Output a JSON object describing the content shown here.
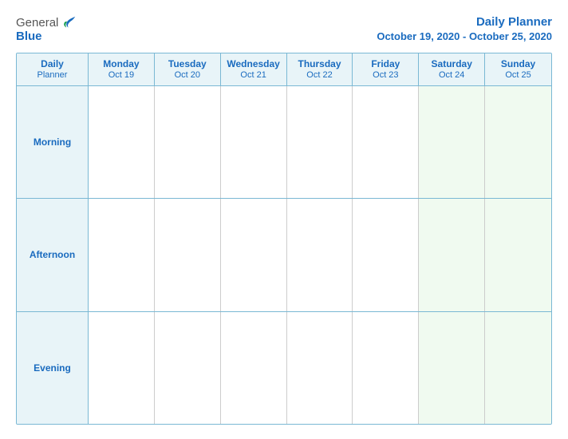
{
  "logo": {
    "general": "General",
    "blue": "Blue"
  },
  "title": {
    "main": "Daily Planner",
    "sub": "October 19, 2020 - October 25, 2020"
  },
  "header_row": {
    "label_line1": "Daily",
    "label_line2": "Planner",
    "days": [
      {
        "day": "Monday",
        "date": "Oct 19"
      },
      {
        "day": "Tuesday",
        "date": "Oct 20"
      },
      {
        "day": "Wednesday",
        "date": "Oct 21"
      },
      {
        "day": "Thursday",
        "date": "Oct 22"
      },
      {
        "day": "Friday",
        "date": "Oct 23"
      },
      {
        "day": "Saturday",
        "date": "Oct 24"
      },
      {
        "day": "Sunday",
        "date": "Oct 25"
      }
    ]
  },
  "rows": [
    {
      "label": "Morning"
    },
    {
      "label": "Afternoon"
    },
    {
      "label": "Evening"
    }
  ]
}
